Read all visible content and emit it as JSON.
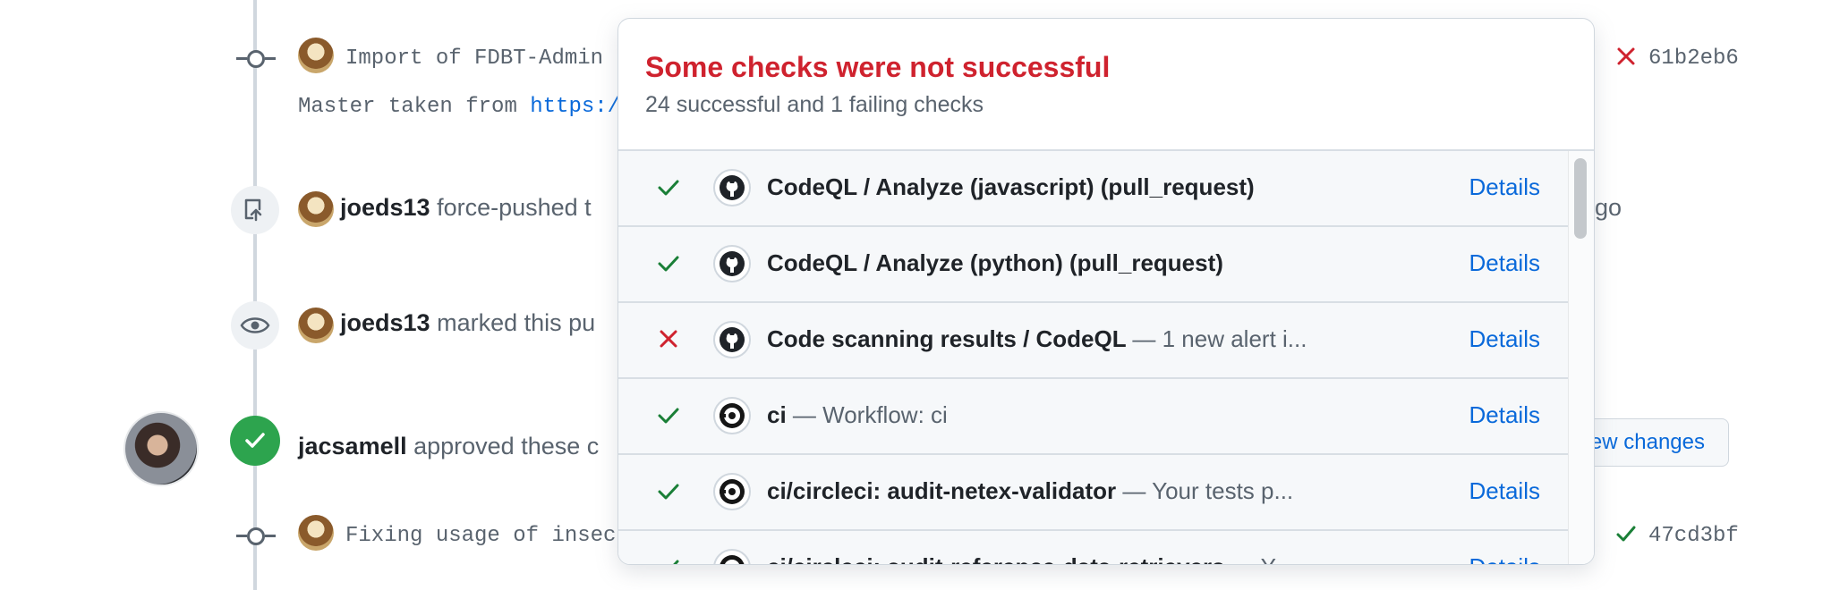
{
  "timeline": {
    "commit1": {
      "message": "Import of FDBT-Admin",
      "sha": "61b2eb6",
      "status": "fail",
      "body_prefix": "Master taken from ",
      "body_link": "https:/"
    },
    "event_push": {
      "user": "joeds13",
      "action": "force-pushed t",
      "trailing": "go"
    },
    "event_ready": {
      "user": "joeds13",
      "action": "marked this pu"
    },
    "event_approved": {
      "user": "jacsamell",
      "action": "approved these c",
      "button_label": "ew changes"
    },
    "commit2": {
      "message": "Fixing usage of insec",
      "sha": "47cd3bf",
      "status": "success"
    }
  },
  "popover": {
    "title": "Some checks were not successful",
    "subtitle": "24 successful and 1 failing checks",
    "checks": [
      {
        "status": "success",
        "app": "github-icon",
        "name": "CodeQL / Analyze (javascript) (pull_request)",
        "desc": "",
        "details": "Details"
      },
      {
        "status": "success",
        "app": "github-icon",
        "name": "CodeQL / Analyze (python) (pull_request)",
        "desc": "",
        "details": "Details"
      },
      {
        "status": "fail",
        "app": "github-icon",
        "name": "Code scanning results / CodeQL",
        "desc": "— 1 new alert i...",
        "details": "Details"
      },
      {
        "status": "success",
        "app": "circleci-icon",
        "name": "ci",
        "desc": "— Workflow: ci",
        "details": "Details"
      },
      {
        "status": "success",
        "app": "circleci-icon",
        "name": "ci/circleci: audit-netex-validator",
        "desc": "— Your tests p...",
        "details": "Details"
      },
      {
        "status": "success",
        "app": "circleci-icon",
        "name": "ci/circleci: audit-reference-data-retrievers",
        "desc": "— Y...",
        "details": "Details"
      }
    ]
  },
  "colors": {
    "fail": "#cf222e",
    "success": "#1a7f37",
    "link": "#0969da",
    "approved": "#2da44e"
  }
}
